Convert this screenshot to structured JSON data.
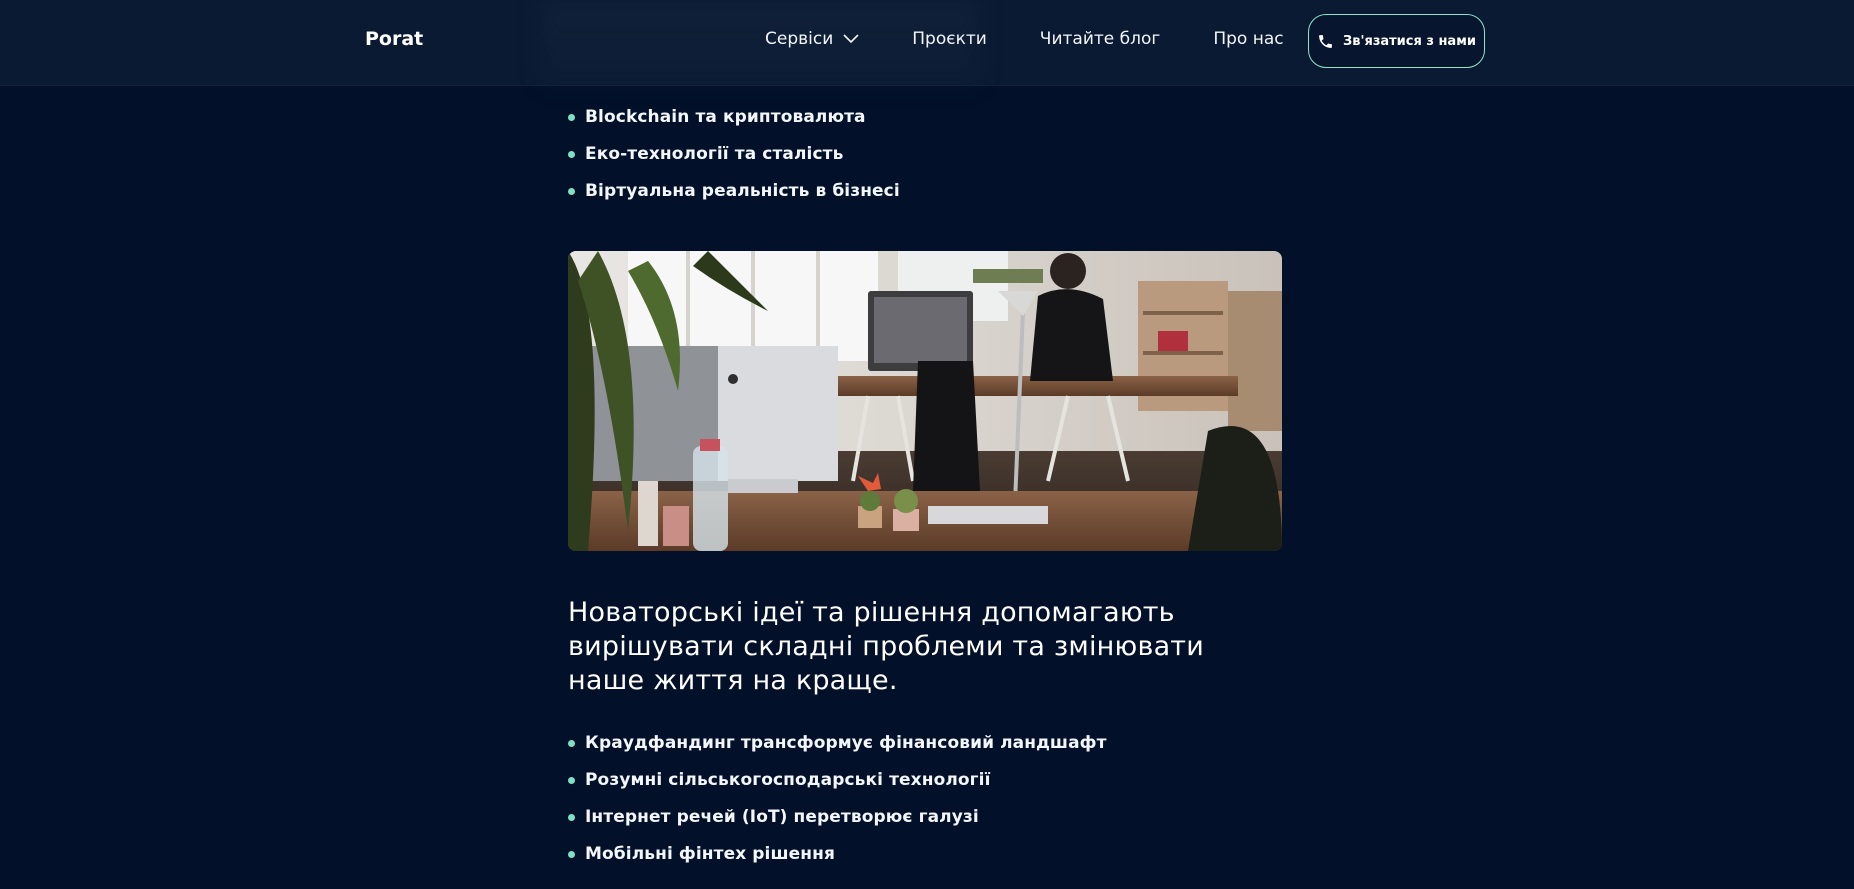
{
  "header": {
    "logo": "Porat",
    "nav": [
      {
        "label": "Сервіси",
        "has_dropdown": true
      },
      {
        "label": "Проєкти"
      },
      {
        "label": "Читайте блог"
      },
      {
        "label": "Про нас"
      }
    ],
    "contact_button": "Зв'язатися з нами",
    "contact_icon": "phone-icon"
  },
  "list_top": [
    "Blockchain та криптовалюта",
    "Еко-технології та сталість",
    "Віртуальна реальність в бізнесі"
  ],
  "photo": {
    "subject": "open office with desks, computers and a man working"
  },
  "heading": "Новаторські ідеї та рішення допомагають вирішувати складні проблеми та змінювати наше життя на краще.",
  "list_bottom": [
    "Краудфандинг трансформує фінансовий ландшафт",
    "Розумні сільськогосподарські технології",
    "Інтернет речей (IoT) перетворює галузі",
    "Мобільні фінтех рішення"
  ],
  "colors": {
    "background": "#021029",
    "header": "#0a1b33",
    "accent": "#7fe0c6",
    "text": "#ffffff"
  }
}
